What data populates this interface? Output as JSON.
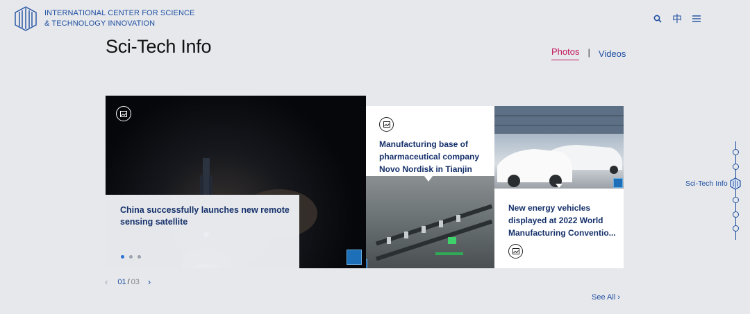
{
  "header": {
    "logo_line1": "INTERNATIONAL CENTER FOR SCIENCE",
    "logo_line2": "& TECHNOLOGY INNOVATION",
    "search_icon": "search-icon",
    "language_toggle": "中",
    "menu_icon": "menu-icon"
  },
  "page": {
    "title": "Sci-Tech Info"
  },
  "tabs": [
    {
      "label": "Photos",
      "active": true
    },
    {
      "label": "Videos",
      "active": false
    }
  ],
  "tab_separator": "|",
  "cards": {
    "hero": {
      "title": "China successfully launches new remote sensing satellite",
      "badge_icon": "image-icon"
    },
    "middle": {
      "title": "Manufacturing base of pharmaceutical company Novo Nordisk in Tianjin",
      "badge_icon": "image-icon"
    },
    "right": {
      "title": "New energy vehicles displayed at 2022 World Manufacturing Conventio...",
      "badge_icon": "image-icon"
    }
  },
  "pager": {
    "current": "01",
    "separator": "/",
    "total": "03",
    "prev_icon": "chevron-left-icon",
    "next_icon": "chevron-right-icon"
  },
  "see_all": "See All ›",
  "side_nav": {
    "active_label": "Sci-Tech Info"
  },
  "colors": {
    "accent": "#1f4fa0",
    "active_tab": "#c2185b",
    "background": "#e6e8ec"
  }
}
